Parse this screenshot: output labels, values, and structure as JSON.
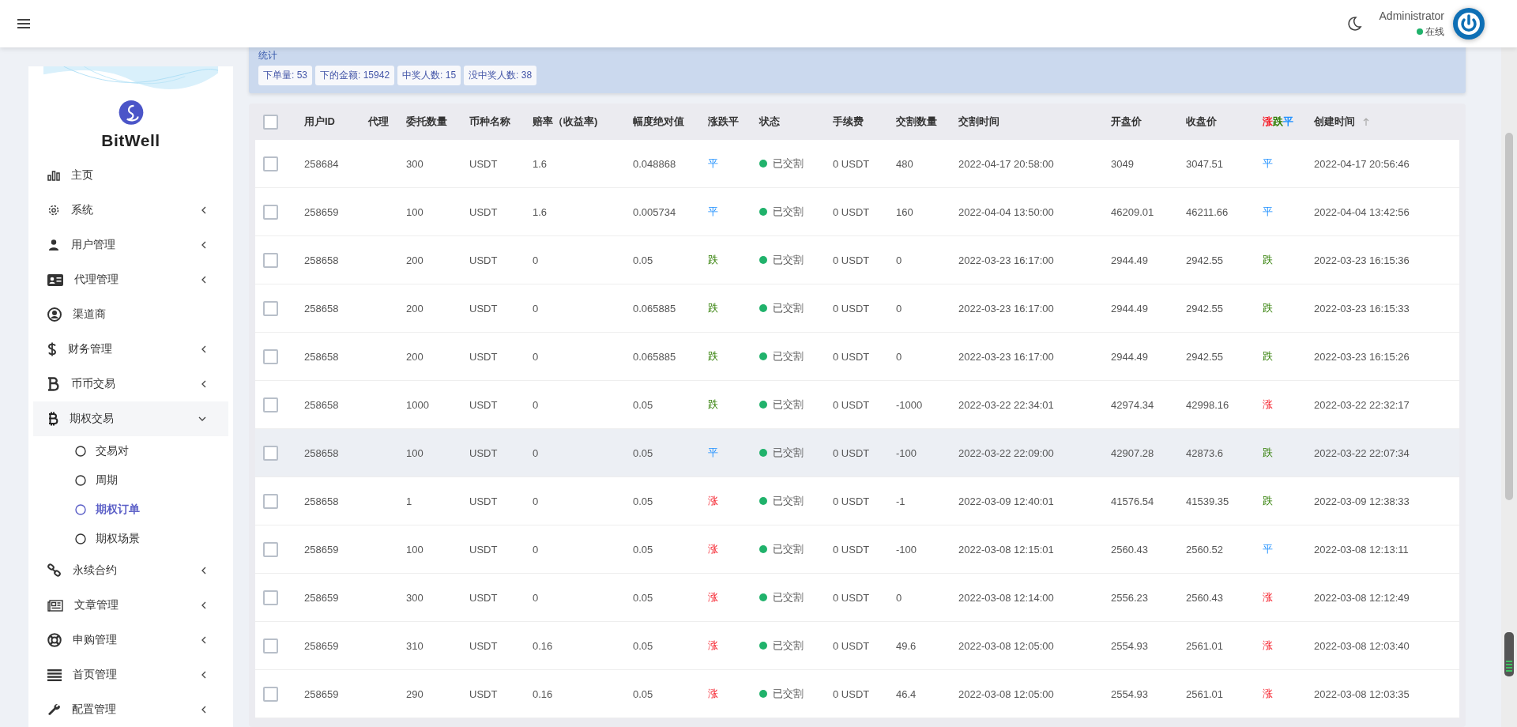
{
  "header": {
    "user_name": "Administrator",
    "status": "在线"
  },
  "sidebar": {
    "brand": "BitWell",
    "items": [
      {
        "label": "主页",
        "has_children": false
      },
      {
        "label": "系统",
        "has_children": true,
        "expanded": false
      },
      {
        "label": "用户管理",
        "has_children": true,
        "expanded": false
      },
      {
        "label": "代理管理",
        "has_children": true,
        "expanded": false
      },
      {
        "label": "渠道商",
        "has_children": false
      },
      {
        "label": "财务管理",
        "has_children": true,
        "expanded": false
      },
      {
        "label": "币币交易",
        "has_children": true,
        "expanded": false
      },
      {
        "label": "期权交易",
        "has_children": true,
        "expanded": true,
        "children": [
          {
            "label": "交易对",
            "selected": false
          },
          {
            "label": "周期",
            "selected": false
          },
          {
            "label": "期权订单",
            "selected": true
          },
          {
            "label": "期权场景",
            "selected": false
          }
        ]
      },
      {
        "label": "永续合约",
        "has_children": true,
        "expanded": false
      },
      {
        "label": "文章管理",
        "has_children": true,
        "expanded": false
      },
      {
        "label": "申购管理",
        "has_children": true,
        "expanded": false
      },
      {
        "label": "首页管理",
        "has_children": true,
        "expanded": false
      },
      {
        "label": "配置管理",
        "has_children": true,
        "expanded": false
      }
    ]
  },
  "stats": {
    "title": "统计",
    "badges": [
      "下单量: 53",
      "下的金额: 15942",
      "中奖人数: 15",
      "没中奖人数: 38"
    ]
  },
  "table": {
    "all_selected": false,
    "columns": [
      {
        "label": "用户ID"
      },
      {
        "label": "代理"
      },
      {
        "label": "委托数量"
      },
      {
        "label": "币种名称"
      },
      {
        "label": "赔率（收益率)"
      },
      {
        "label": "幅度绝对值"
      },
      {
        "label": "涨跌平"
      },
      {
        "label": "状态"
      },
      {
        "label": "手续费"
      },
      {
        "label": "交割数量"
      },
      {
        "label": "交割时间"
      },
      {
        "label": "开盘价"
      },
      {
        "label": "收盘价"
      },
      {
        "parts": [
          {
            "text": "涨",
            "kind": "up"
          },
          {
            "text": "跌",
            "kind": "down"
          },
          {
            "text": "平",
            "kind": "flat"
          }
        ]
      },
      {
        "label": "创建时间",
        "sortable": true
      }
    ],
    "rows": [
      {
        "checked": false,
        "hovered": false,
        "user_id": "258684",
        "quantity": "300",
        "coin": "USDT",
        "rate": "1.6",
        "amplitude": "0.048868",
        "trend": {
          "text": "平",
          "kind": "flat"
        },
        "status": "已交割",
        "fee": "0 USDT",
        "settle_quantity": "480",
        "settle_time": "2022-04-17 20:58:00",
        "open": "3049",
        "close": "3047.51",
        "result": {
          "text": "平",
          "kind": "flat"
        },
        "created": "2022-04-17 20:56:46"
      },
      {
        "checked": false,
        "hovered": false,
        "user_id": "258659",
        "quantity": "100",
        "coin": "USDT",
        "rate": "1.6",
        "amplitude": "0.005734",
        "trend": {
          "text": "平",
          "kind": "flat"
        },
        "status": "已交割",
        "fee": "0 USDT",
        "settle_quantity": "160",
        "settle_time": "2022-04-04 13:50:00",
        "open": "46209.01",
        "close": "46211.66",
        "result": {
          "text": "平",
          "kind": "flat"
        },
        "created": "2022-04-04 13:42:56"
      },
      {
        "checked": false,
        "hovered": false,
        "user_id": "258658",
        "quantity": "200",
        "coin": "USDT",
        "rate": "0",
        "amplitude": "0.05",
        "trend": {
          "text": "跌",
          "kind": "down"
        },
        "status": "已交割",
        "fee": "0 USDT",
        "settle_quantity": "0",
        "settle_time": "2022-03-23 16:17:00",
        "open": "2944.49",
        "close": "2942.55",
        "result": {
          "text": "跌",
          "kind": "down"
        },
        "created": "2022-03-23 16:15:36"
      },
      {
        "checked": false,
        "hovered": false,
        "user_id": "258658",
        "quantity": "200",
        "coin": "USDT",
        "rate": "0",
        "amplitude": "0.065885",
        "trend": {
          "text": "跌",
          "kind": "down"
        },
        "status": "已交割",
        "fee": "0 USDT",
        "settle_quantity": "0",
        "settle_time": "2022-03-23 16:17:00",
        "open": "2944.49",
        "close": "2942.55",
        "result": {
          "text": "跌",
          "kind": "down"
        },
        "created": "2022-03-23 16:15:33"
      },
      {
        "checked": false,
        "hovered": false,
        "user_id": "258658",
        "quantity": "200",
        "coin": "USDT",
        "rate": "0",
        "amplitude": "0.065885",
        "trend": {
          "text": "跌",
          "kind": "down"
        },
        "status": "已交割",
        "fee": "0 USDT",
        "settle_quantity": "0",
        "settle_time": "2022-03-23 16:17:00",
        "open": "2944.49",
        "close": "2942.55",
        "result": {
          "text": "跌",
          "kind": "down"
        },
        "created": "2022-03-23 16:15:26"
      },
      {
        "checked": false,
        "hovered": false,
        "user_id": "258658",
        "quantity": "1000",
        "coin": "USDT",
        "rate": "0",
        "amplitude": "0.05",
        "trend": {
          "text": "跌",
          "kind": "down"
        },
        "status": "已交割",
        "fee": "0 USDT",
        "settle_quantity": "-1000",
        "settle_time": "2022-03-22 22:34:01",
        "open": "42974.34",
        "close": "42998.16",
        "result": {
          "text": "涨",
          "kind": "up"
        },
        "created": "2022-03-22 22:32:17"
      },
      {
        "checked": false,
        "hovered": true,
        "user_id": "258658",
        "quantity": "100",
        "coin": "USDT",
        "rate": "0",
        "amplitude": "0.05",
        "trend": {
          "text": "平",
          "kind": "flat"
        },
        "status": "已交割",
        "fee": "0 USDT",
        "settle_quantity": "-100",
        "settle_time": "2022-03-22 22:09:00",
        "open": "42907.28",
        "close": "42873.6",
        "result": {
          "text": "跌",
          "kind": "down"
        },
        "created": "2022-03-22 22:07:34"
      },
      {
        "checked": false,
        "hovered": false,
        "user_id": "258658",
        "quantity": "1",
        "coin": "USDT",
        "rate": "0",
        "amplitude": "0.05",
        "trend": {
          "text": "涨",
          "kind": "up"
        },
        "status": "已交割",
        "fee": "0 USDT",
        "settle_quantity": "-1",
        "settle_time": "2022-03-09 12:40:01",
        "open": "41576.54",
        "close": "41539.35",
        "result": {
          "text": "跌",
          "kind": "down"
        },
        "created": "2022-03-09 12:38:33"
      },
      {
        "checked": false,
        "hovered": false,
        "user_id": "258659",
        "quantity": "100",
        "coin": "USDT",
        "rate": "0",
        "amplitude": "0.05",
        "trend": {
          "text": "涨",
          "kind": "up"
        },
        "status": "已交割",
        "fee": "0 USDT",
        "settle_quantity": "-100",
        "settle_time": "2022-03-08 12:15:01",
        "open": "2560.43",
        "close": "2560.52",
        "result": {
          "text": "平",
          "kind": "flat"
        },
        "created": "2022-03-08 12:13:11"
      },
      {
        "checked": false,
        "hovered": false,
        "user_id": "258659",
        "quantity": "300",
        "coin": "USDT",
        "rate": "0",
        "amplitude": "0.05",
        "trend": {
          "text": "涨",
          "kind": "up"
        },
        "status": "已交割",
        "fee": "0 USDT",
        "settle_quantity": "0",
        "settle_time": "2022-03-08 12:14:00",
        "open": "2556.23",
        "close": "2560.43",
        "result": {
          "text": "涨",
          "kind": "up"
        },
        "created": "2022-03-08 12:12:49"
      },
      {
        "checked": false,
        "hovered": false,
        "user_id": "258659",
        "quantity": "310",
        "coin": "USDT",
        "rate": "0.16",
        "amplitude": "0.05",
        "trend": {
          "text": "涨",
          "kind": "up"
        },
        "status": "已交割",
        "fee": "0 USDT",
        "settle_quantity": "49.6",
        "settle_time": "2022-03-08 12:05:00",
        "open": "2554.93",
        "close": "2561.01",
        "result": {
          "text": "涨",
          "kind": "up"
        },
        "created": "2022-03-08 12:03:40"
      },
      {
        "checked": false,
        "hovered": false,
        "user_id": "258659",
        "quantity": "290",
        "coin": "USDT",
        "rate": "0.16",
        "amplitude": "0.05",
        "trend": {
          "text": "涨",
          "kind": "up"
        },
        "status": "已交割",
        "fee": "0 USDT",
        "settle_quantity": "46.4",
        "settle_time": "2022-03-08 12:05:00",
        "open": "2554.93",
        "close": "2561.01",
        "result": {
          "text": "涨",
          "kind": "up"
        },
        "created": "2022-03-08 12:03:35"
      }
    ]
  }
}
